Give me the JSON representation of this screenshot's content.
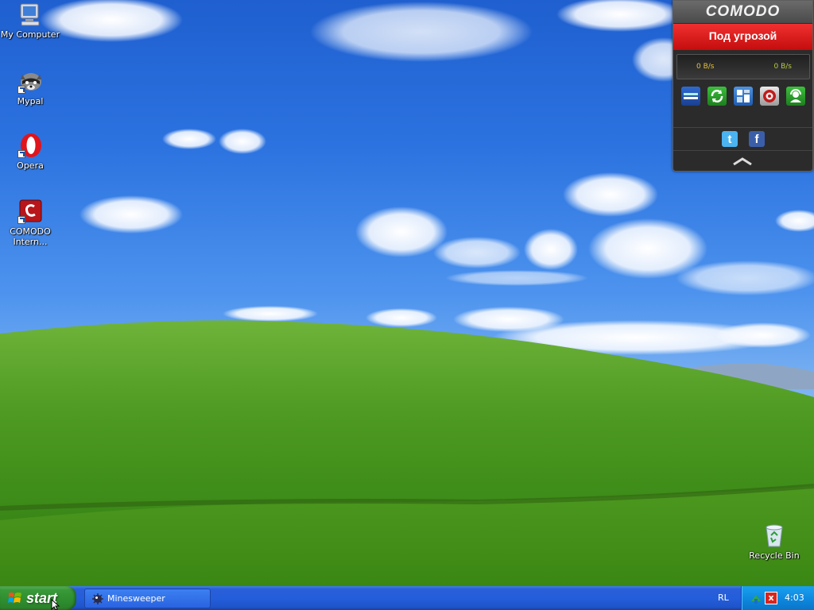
{
  "desktop": {
    "icons": [
      {
        "label": "My Computer",
        "icon": "my-computer-icon"
      },
      {
        "label": "Mypal",
        "icon": "mypal-raccoon-icon"
      },
      {
        "label": "Opera",
        "icon": "opera-icon"
      },
      {
        "label": "COMODO Intern...",
        "icon": "comodo-internet-security-icon"
      },
      {
        "label": "Recycle Bin",
        "icon": "recycle-bin-icon"
      }
    ]
  },
  "comodo_widget": {
    "brand": "COMODO",
    "status": "Под угрозой",
    "status_color": "#d91515",
    "traffic_in": "0 B/s",
    "traffic_out": "0 B/s",
    "tools": [
      "sandbox-tool-icon",
      "update-tool-icon",
      "tasks-tool-icon",
      "scan-tool-icon",
      "support-tool-icon"
    ],
    "social": [
      {
        "icon": "twitter-icon",
        "glyph": "t"
      },
      {
        "icon": "facebook-icon",
        "glyph": "f"
      }
    ],
    "collapse_icon": "chevron-up-icon"
  },
  "taskbar": {
    "start_label": "start",
    "tasks": [
      {
        "label": "Minesweeper",
        "icon": "minesweeper-icon"
      }
    ],
    "language": "RL",
    "tray_icons": [
      "network-icon",
      "comodo-tray-icon"
    ],
    "clock": "4:03"
  }
}
